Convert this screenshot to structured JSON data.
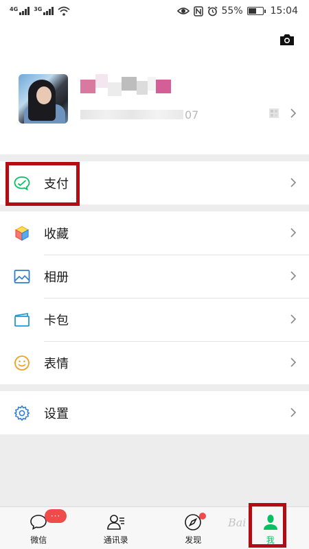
{
  "status_bar": {
    "network_1": "4G",
    "network_2": "3G",
    "battery_percent": "55%",
    "battery_level": 0.55,
    "time": "15:04"
  },
  "profile": {
    "wechat_id_suffix": "07"
  },
  "menu": {
    "pay": "支付",
    "favorites": "收藏",
    "album": "相册",
    "cards": "卡包",
    "stickers": "表情",
    "settings": "设置"
  },
  "tabbar": {
    "chats": "微信",
    "chats_badge": "···",
    "contacts": "通讯录",
    "discover": "发现",
    "me": "我"
  },
  "watermark": "Bai",
  "colors": {
    "accent_green": "#07c160",
    "badge_red": "#f04b4b",
    "annotation_red": "#b30c12"
  }
}
